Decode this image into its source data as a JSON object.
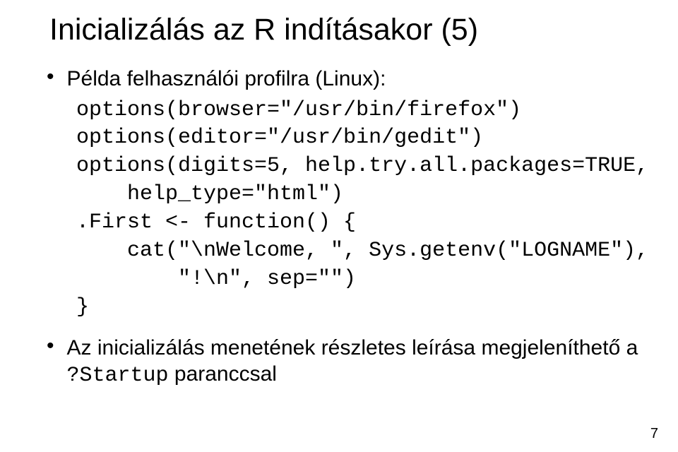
{
  "title": "Inicializálás az R indításakor (5)",
  "bullet1": "Példa felhasználói profilra (Linux):",
  "code": {
    "l1": "options(browser=\"/usr/bin/firefox\")",
    "l2": "options(editor=\"/usr/bin/gedit\")",
    "l3": "options(digits=5, help.try.all.packages=TRUE,",
    "l4": "    help_type=\"html\")",
    "l5": ".First <- function() {",
    "l6": "    cat(\"\\nWelcome, \", Sys.getenv(\"LOGNAME\"),",
    "l7": "        \"!\\n\", sep=\"\")",
    "l8": "}"
  },
  "bullet2_a": "Az inicializálás menetének részletes leírása megjeleníthető a ",
  "bullet2_b": "?Startup",
  "bullet2_c": " paranccsal",
  "page_number": "7"
}
